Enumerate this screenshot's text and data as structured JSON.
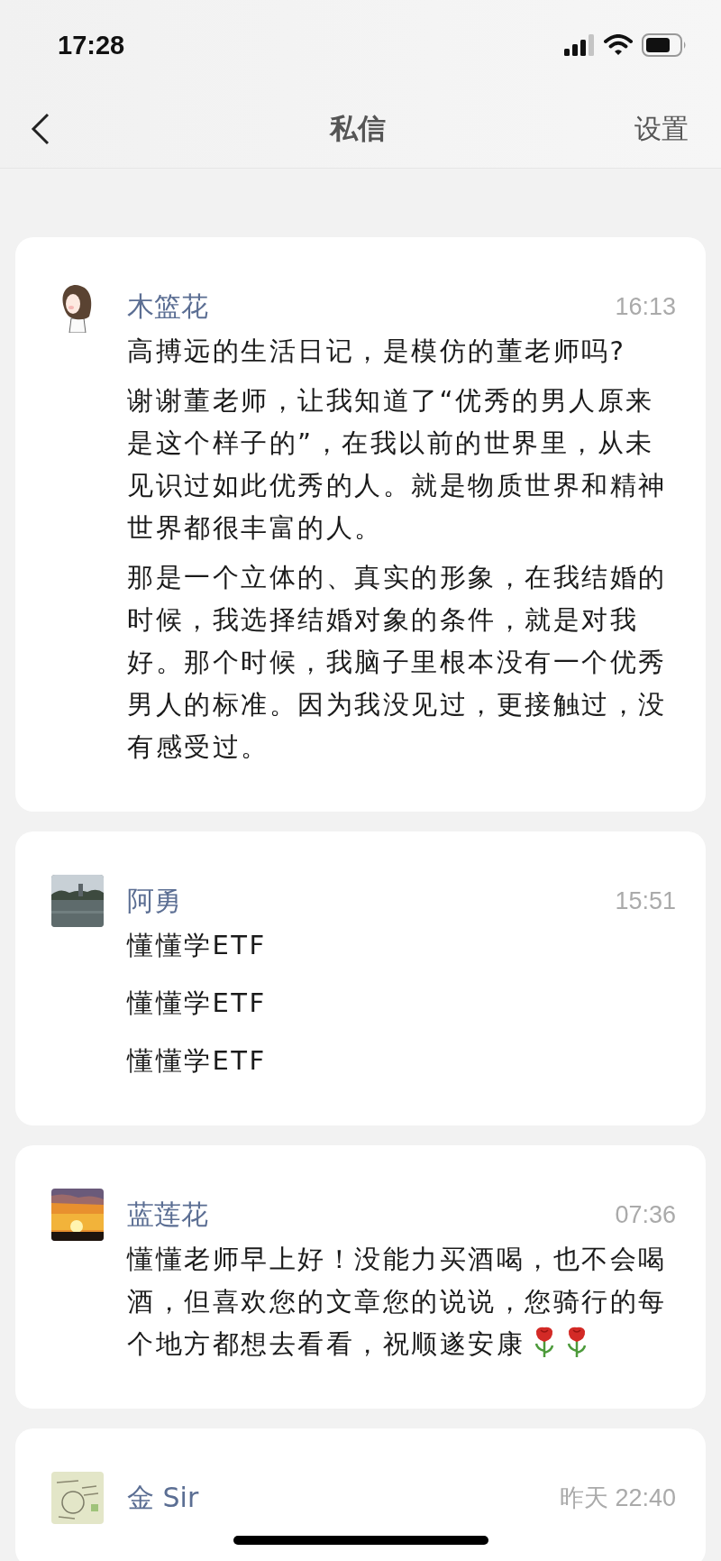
{
  "status_bar": {
    "time": "17:28"
  },
  "nav": {
    "title": "私信",
    "action": "设置"
  },
  "conversations": [
    {
      "avatar": {
        "kind": "picture"
      },
      "name": "木篮花",
      "time": "16:13",
      "messages": [
        "高搏远的生活日记，是模仿的董老师吗?",
        "谢谢董老师，让我知道了“优秀的男人原来是这个样子的”，在我以前的世界里，从未见识过如此优秀的人。就是物质世界和精神世界都很丰富的人。",
        "那是一个立体的、真实的形象，在我结婚的时候，我选择结婚对象的条件，就是对我好。那个时候，我脑子里根本没有一个优秀男人的标准。因为我没见过，更接触过，没有感受过。"
      ]
    },
    {
      "avatar": {
        "kind": "picture"
      },
      "name": "阿勇",
      "time": "15:51",
      "messages": [
        "懂懂学ETF",
        "懂懂学ETF",
        "懂懂学ETF"
      ]
    },
    {
      "avatar": {
        "kind": "picture"
      },
      "name": "蓝莲花",
      "time": "07:36",
      "messages": [
        "懂懂老师早上好！没能力买酒喝，也不会喝酒，但喜欢您的文章您的说说，您骑行的每个地方都想去看看，祝顺遂安康"
      ],
      "emojis": [
        {
          "kind": "rose"
        },
        {
          "kind": "rose"
        }
      ]
    },
    {
      "avatar": {
        "kind": "picture"
      },
      "name": "金 Sir",
      "time": "昨天 22:40"
    }
  ]
}
